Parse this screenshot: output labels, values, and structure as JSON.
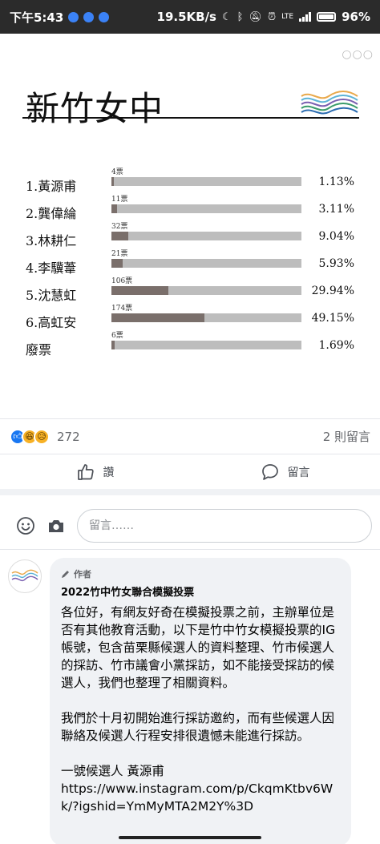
{
  "status_bar": {
    "time": "下午5:43",
    "net_speed": "19.5KB/s",
    "lte": "LTE",
    "battery": "96%"
  },
  "post_image": {
    "school": "新竹女中",
    "candidates": [
      {
        "name": "1.黃源甫",
        "votes_label": "4票",
        "percent_label": "1.13%",
        "votes": 4,
        "share": 0.0113
      },
      {
        "name": "2.龔偉綸",
        "votes_label": "11票",
        "percent_label": "3.11%",
        "votes": 11,
        "share": 0.0311
      },
      {
        "name": "3.林耕仁",
        "votes_label": "32票",
        "percent_label": "9.04%",
        "votes": 32,
        "share": 0.0904
      },
      {
        "name": "4.李驥葦",
        "votes_label": "21票",
        "percent_label": "5.93%",
        "votes": 21,
        "share": 0.0593
      },
      {
        "name": "5.沈慧虹",
        "votes_label": "106票",
        "percent_label": "29.94%",
        "votes": 106,
        "share": 0.2994
      },
      {
        "name": "6.高虹安",
        "votes_label": "174票",
        "percent_label": "49.15%",
        "votes": 174,
        "share": 0.4915
      },
      {
        "name": "廢票",
        "votes_label": "6票",
        "percent_label": "1.69%",
        "votes": 6,
        "share": 0.0169
      }
    ],
    "colors": {
      "track": "#bdbdbd",
      "fill": "#7a6f6b"
    }
  },
  "reactions": {
    "count": "272",
    "comments": "2 則留言",
    "icons": [
      "like-icon",
      "haha-icon",
      "sad-icon"
    ]
  },
  "actions": {
    "like_label": "讚",
    "comment_label": "留言"
  },
  "composer": {
    "placeholder": "留言……"
  },
  "comment": {
    "author_label": "作者",
    "title": "2022竹中竹女聯合模擬投票",
    "body": "各位好，有網友好奇在模擬投票之前，主辦單位是否有其他教育活動，以下是竹中竹女模擬投票的IG 帳號，包含苗栗縣候選人的資料整理、竹市候選人的採訪、竹市議會小黨採訪，如不能接受採訪的候選人，我們也整理了相關資料。\n\n我們於十月初開始進行採訪邀約，而有些候選人因聯絡及候選人行程安排很遺憾未能進行採訪。\n\n一號候選人 黃源甫\nhttps://www.instagram.com/p/CkqmKtbv6Wk/?igshid=YmMyMTA2M2Y%3D"
  }
}
